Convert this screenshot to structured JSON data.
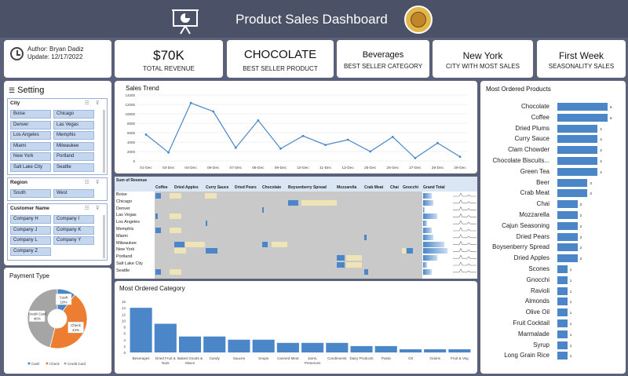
{
  "header": {
    "title": "Product Sales Dashboard"
  },
  "author": {
    "author": "Author: Bryan Dadiz",
    "update": "Update: 12/17/2022"
  },
  "kpis": [
    {
      "value": "$70K",
      "label": "TOTAL REVENUE"
    },
    {
      "value": "CHOCOLATE",
      "label": "BEST SELLER PRODUCT"
    },
    {
      "value": "Beverages",
      "label": "BEST SELLER CATEGORY"
    },
    {
      "value": "New York",
      "label": "CITY WITH MOST SALES"
    },
    {
      "value": "First Week",
      "label": "SEASONALITY SALES"
    }
  ],
  "setting": {
    "title": "Setting",
    "city": {
      "header": "City",
      "items": [
        "Boise",
        "Chicago",
        "Denver",
        "Las Vegas",
        "Los Angeles",
        "Memphis",
        "Miami",
        "Milwaukee",
        "New York",
        "Portland",
        "Salt Lake City",
        "Seattle"
      ]
    },
    "region": {
      "header": "Region",
      "items": [
        "South",
        "West"
      ]
    },
    "customer": {
      "header": "Customer Name",
      "items": [
        "Company H",
        "Company I",
        "Company J",
        "Company K",
        "Company L",
        "Company Y",
        "Company Z"
      ]
    }
  },
  "payment": {
    "title": "Payment Type",
    "legend": [
      "Cash",
      "Check",
      "Credit Card"
    ],
    "colors": [
      "#4a86c8",
      "#ed7d31",
      "#a5a5a5"
    ],
    "slice_labels": [
      {
        "name": "Cash",
        "pct": "10%"
      },
      {
        "name": "Check",
        "pct": "44%"
      },
      {
        "name": "Credit Card",
        "pct": "46%"
      }
    ]
  },
  "pivot": {
    "title": "Sum of Revenue",
    "columns": [
      "Coffee",
      "Dried Apples",
      "Curry Sauce",
      "Dried Pears",
      "Chocolate",
      "Boysenberry Spread",
      "Mozzarella",
      "Crab Meat",
      "Chai",
      "Gnocchi",
      "Grand Total"
    ],
    "rows": [
      "Boise",
      "Chicago",
      "Denver",
      "Las Vegas",
      "Los Angeles",
      "Memphis",
      "Miami",
      "Milwaukee",
      "New York",
      "Portland",
      "Salt Lake City",
      "Seattle"
    ]
  },
  "chart_data": [
    {
      "type": "line",
      "title": "Sales Trend",
      "x": [
        "01-Dec",
        "03-Dec",
        "04-Dec",
        "06-Dec",
        "07-Dec",
        "08-Dec",
        "09-Dec",
        "10-Dec",
        "11-Dec",
        "12-Dec",
        "25-Dec",
        "26-Dec",
        "27-Dec",
        "28-Dec",
        "29-Dec"
      ],
      "values": [
        5600,
        1800,
        12300,
        10500,
        2800,
        8600,
        2600,
        5300,
        3400,
        4500,
        2000,
        5100,
        600,
        3800,
        900
      ],
      "ylim": [
        0,
        14000
      ],
      "yticks": [
        0,
        2000,
        4000,
        6000,
        8000,
        10000,
        12000,
        14000
      ],
      "color": "#4a86c8"
    },
    {
      "type": "bar",
      "title": "Most Ordered Category",
      "categories": [
        "Beverages",
        "Dried Fruit & Nuts",
        "Baked Goods & Mixes",
        "Candy",
        "Sauces",
        "Soups",
        "Canned Meat",
        "Jams, Preserves",
        "Condiments",
        "Dairy Products",
        "Pasta",
        "Oil",
        "Grains",
        "Fruit & Veg"
      ],
      "values": [
        14,
        9,
        5,
        5,
        4,
        4,
        3,
        3,
        3,
        2,
        2,
        1,
        1,
        1
      ],
      "ylim": [
        0,
        16
      ],
      "yticks": [
        0,
        2,
        4,
        6,
        8,
        10,
        12,
        14,
        16
      ],
      "color": "#4a86c8"
    },
    {
      "type": "bar",
      "orientation": "horizontal",
      "title": "Most Ordered Products",
      "categories": [
        "Chocolate",
        "Coffee",
        "Dried Plums",
        "Curry Sauce",
        "Clam Chowder",
        "Chocolate Biscuits...",
        "Green Tea",
        "Beer",
        "Crab Meat",
        "Chai",
        "Mozzarella",
        "Cajun Seasoning",
        "Dried Pears",
        "Boysenberry Spread",
        "Dried Apples",
        "Scones",
        "Gnocchi",
        "Ravioli",
        "Almonds",
        "Olive Oil",
        "Fruit Cocktail",
        "Marmalade",
        "Syrup",
        "Long Grain Rice"
      ],
      "values": [
        5,
        5,
        4,
        4,
        4,
        4,
        4,
        3,
        3,
        2,
        2,
        2,
        2,
        2,
        2,
        1,
        1,
        1,
        1,
        1,
        1,
        1,
        1,
        1
      ],
      "color": "#4a86c8"
    },
    {
      "type": "pie",
      "title": "Payment Type",
      "labels": [
        "Cash",
        "Check",
        "Credit Card"
      ],
      "values": [
        10,
        44,
        46
      ]
    }
  ]
}
